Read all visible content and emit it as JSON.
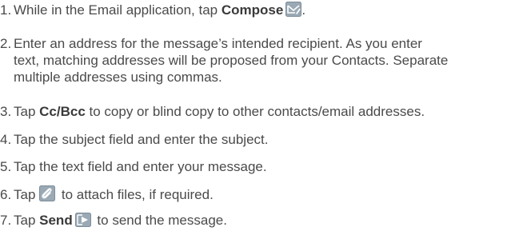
{
  "steps": [
    {
      "number": "1.",
      "text_before": "While in the Email application, tap ",
      "bold": "Compose",
      "text_after": ".",
      "icon": "compose-envelope-icon"
    },
    {
      "number": "2.",
      "lines": [
        "Enter an address for the message’s intended recipient. As you enter",
        "text, matching addresses will be proposed from your Contacts. Separate",
        "multiple addresses using commas."
      ]
    },
    {
      "number": "3.",
      "text_before": "Tap ",
      "bold": "Cc/Bcc",
      "text_after": " to copy or blind copy to other contacts/email addresses."
    },
    {
      "number": "4.",
      "text": "Tap the subject field and enter the subject."
    },
    {
      "number": "5.",
      "text": "Tap the text field and enter your message."
    },
    {
      "number": "6.",
      "text_before": "Tap ",
      "text_after": " to attach files, if required.",
      "icon": "paperclip-attach-icon"
    },
    {
      "number": "7.",
      "text_before": "Tap ",
      "bold": "Send",
      "text_after": " to send the message.",
      "icon": "send-arrow-icon"
    }
  ],
  "colors": {
    "text": "#4a4a4a",
    "icon_bg": "#8fa0ac",
    "icon_fg": "#ffffff"
  }
}
